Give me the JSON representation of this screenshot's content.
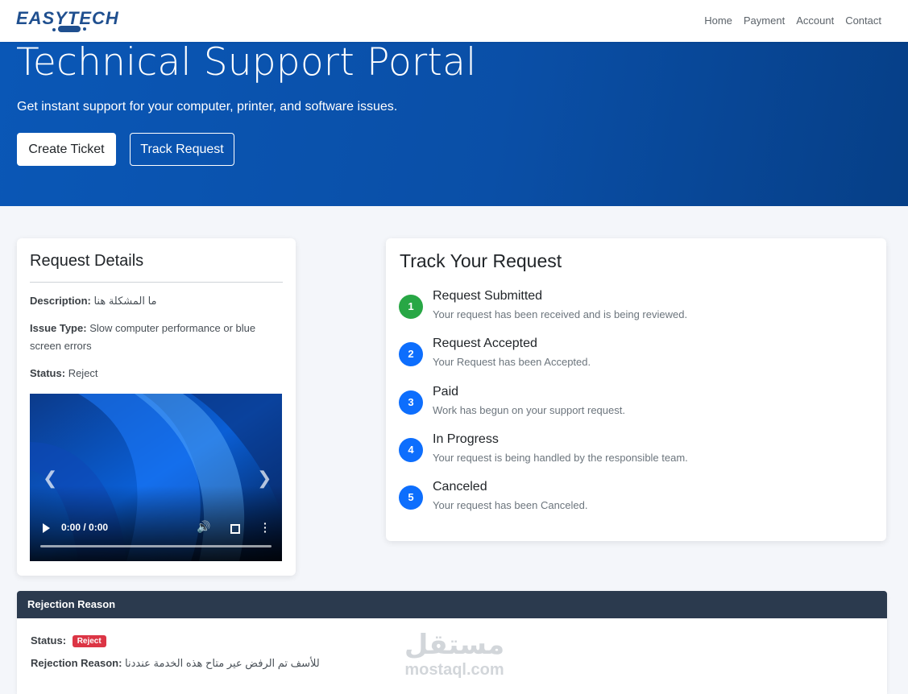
{
  "nav": {
    "brand": "EASYTECH",
    "links": [
      "Home",
      "Payment",
      "Account",
      "Contact"
    ]
  },
  "hero": {
    "title": "Technical Support Portal",
    "subtitle": "Get instant support for your computer, printer, and software issues.",
    "create_label": "Create Ticket",
    "track_label": "Track Request"
  },
  "details": {
    "title": "Request Details",
    "description_label": "Description:",
    "description_value": "ما المشكلة هنا",
    "issue_label": "Issue Type:",
    "issue_value": "Slow computer performance or blue screen errors",
    "status_label": "Status:",
    "status_value": "Reject",
    "video": {
      "time": "0:00 / 0:00",
      "progress": 0
    }
  },
  "track": {
    "title": "Track Your Request",
    "steps": [
      {
        "number": "1",
        "title": "Request Submitted",
        "description": "Your request has been received and is being reviewed.",
        "color": "#28a745"
      },
      {
        "number": "2",
        "title": "Request Accepted",
        "description": "Your Request has been Accepted.",
        "color": "#0d6efd"
      },
      {
        "number": "3",
        "title": "Paid",
        "description": "Work has begun on your support request.",
        "color": "#0d6efd"
      },
      {
        "number": "4",
        "title": "In Progress",
        "description": "Your request is being handled by the responsible team.",
        "color": "#0d6efd"
      },
      {
        "number": "5",
        "title": "Canceled",
        "description": "Your request has been Canceled.",
        "color": "#0d6efd"
      }
    ]
  },
  "rejection": {
    "header": "Rejection Reason",
    "status_label": "Status:",
    "status_badge": "Reject",
    "reason_label": "Rejection Reason:",
    "reason_value": "للأسف تم الرفض عير متاح هذه الخدمة عنددنا"
  },
  "watermark": {
    "arabic": "مستقل",
    "latin": "mostaql.com"
  },
  "colors": {
    "hero": "#0a57b6",
    "brand": "#1f4f8f",
    "reject": "#dc3545",
    "header_dark": "#2b3a4e"
  }
}
